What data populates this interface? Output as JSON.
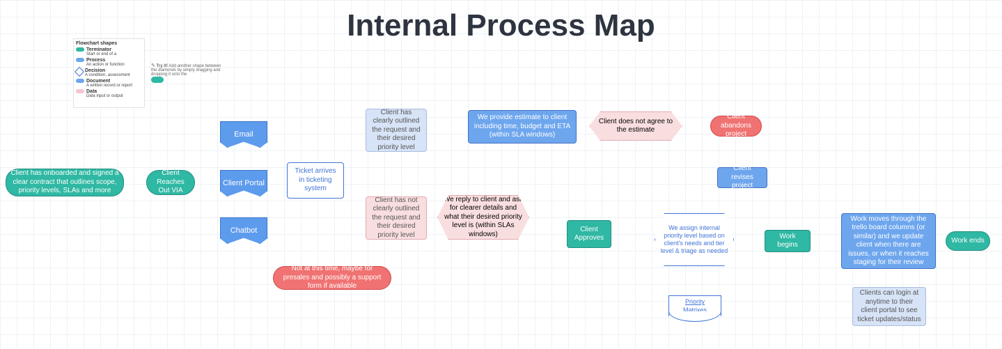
{
  "title": "Internal Process Map",
  "legend": {
    "heading": "Flowchart shapes",
    "items": [
      {
        "label": "Terminator",
        "hint": "Start or end of a",
        "color": "#2fb8a3"
      },
      {
        "label": "Process",
        "hint": "An action or function",
        "color": "#6ea6ee"
      },
      {
        "label": "Decision",
        "hint": "A condition, assessment",
        "color": "#ffffff"
      },
      {
        "label": "Document",
        "hint": "A written record or report",
        "color": "#6ea6ee"
      },
      {
        "label": "Data",
        "hint": "Data input or output",
        "color": "#f5c6d0"
      }
    ]
  },
  "tryit": {
    "label": "Try it!",
    "hint": "Add another shape between the diamonds by simply dragging and dropping it onto the"
  },
  "nodes": {
    "start": "Client has onboarded and signed a clear contract that outlines scope, priority levels, SLAs and more",
    "reach": "Client Reaches Out VIA",
    "email": "Email",
    "portal": "Client Portal",
    "chatbot": "Chatbot",
    "ticket": "Ticket arrives in ticketing system",
    "clear": "Client has clearly outlined the request and their desired priority level",
    "notclear": "Client has not clearly outlined the request and their desired priority level",
    "askclear": "We reply to client and ask for clearer details and what their desired priority level is (within SLAs windows)",
    "estimate": "We provide estimate to client including time, budget and ETA (within SLA windows)",
    "disagree": "Client does not agree to the estimate",
    "abandon": "Client abandons project",
    "revises": "Client revises project",
    "approves": "Client Approves",
    "assign": "We assign internal priority level based on client's needs and tier level & triage as needed",
    "priorityMatrix": "Priority Matrixes",
    "begins": "Work begins",
    "moves": "Work moves through the trello board columns (or similar) and we update client when there are issues, or when it reaches staging for their review",
    "login": "Clients can login at anytime to their client portal to see ticket updates/status",
    "ends": "Work ends",
    "chatnote": "Not at this time, maybe for presales and possibly a support form if available"
  }
}
